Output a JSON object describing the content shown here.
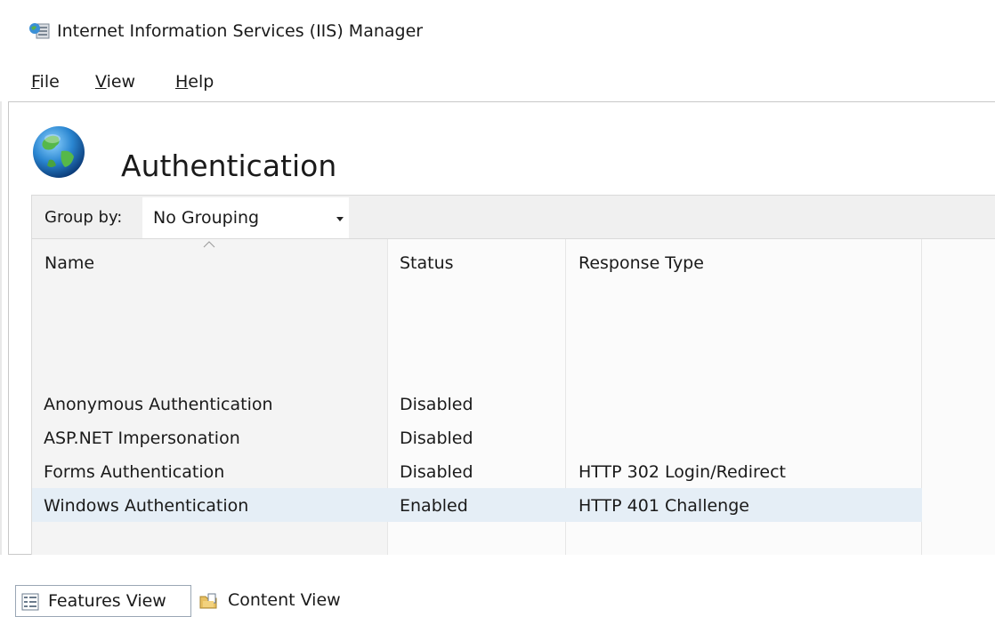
{
  "window": {
    "title": "Internet Information Services (IIS) Manager",
    "app_icon": "iis-manager-icon"
  },
  "menu": {
    "items": [
      {
        "accel": "F",
        "rest": "ile"
      },
      {
        "accel": "V",
        "rest": "iew"
      },
      {
        "accel": "H",
        "rest": "elp"
      }
    ]
  },
  "page": {
    "title": "Authentication",
    "icon": "globe-icon"
  },
  "group_by": {
    "label": "Group by:",
    "selected": "No Grouping"
  },
  "table": {
    "columns": [
      "Name",
      "Status",
      "Response Type"
    ],
    "rows": [
      {
        "name": "Anonymous Authentication",
        "status": "Disabled",
        "response": ""
      },
      {
        "name": "ASP.NET Impersonation",
        "status": "Disabled",
        "response": ""
      },
      {
        "name": "Forms Authentication",
        "status": "Disabled",
        "response": "HTTP 302 Login/Redirect"
      },
      {
        "name": "Windows Authentication",
        "status": "Enabled",
        "response": "HTTP 401 Challenge"
      }
    ],
    "selected_row": 3
  },
  "views": {
    "features": "Features View",
    "content": "Content View"
  },
  "colors": {
    "selection": "#e5eef6",
    "toolbar": "#f0f0f0",
    "border": "#c8c8c8"
  }
}
